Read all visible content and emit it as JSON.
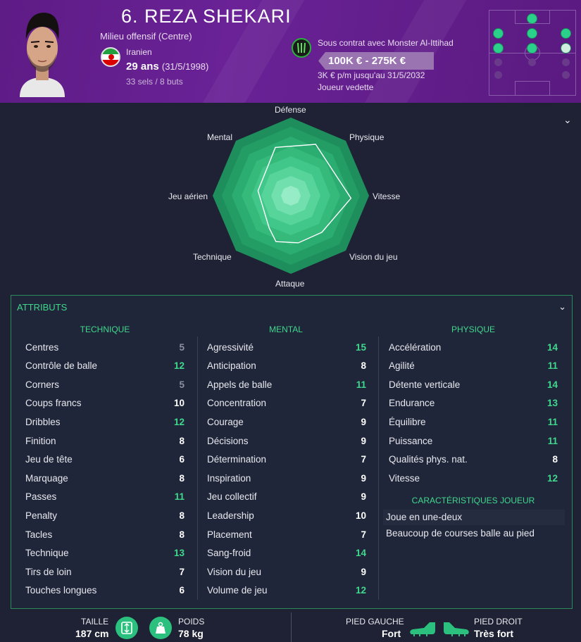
{
  "header": {
    "name": "6. REZA SHEKARI",
    "position": "Milieu offensif (Centre)",
    "nationality": "Iranien",
    "age": "29 ans",
    "dob": "(31/5/1998)",
    "caps": "33 sels / 8 buts",
    "contract": "Sous contrat avec Monster Al-Ittihad",
    "wage_range": "100K € - 275K €",
    "wage_detail": "3K € p/m jusqu'au 31/5/2032",
    "status": "Joueur vedette"
  },
  "radar": {
    "labels": {
      "defense": "Défense",
      "physique": "Physique",
      "vitesse": "Vitesse",
      "vision": "Vision du jeu",
      "attaque": "Attaque",
      "technique": "Technique",
      "jeu_aerien": "Jeu aérien",
      "mental": "Mental"
    }
  },
  "attributes": {
    "title": "ATTRIBUTS",
    "technique": {
      "heading": "TECHNIQUE",
      "rows": [
        {
          "label": "Centres",
          "value": "5"
        },
        {
          "label": "Contrôle de balle",
          "value": "12"
        },
        {
          "label": "Corners",
          "value": "5"
        },
        {
          "label": "Coups francs",
          "value": "10"
        },
        {
          "label": "Dribbles",
          "value": "12"
        },
        {
          "label": "Finition",
          "value": "8"
        },
        {
          "label": "Jeu de tête",
          "value": "6"
        },
        {
          "label": "Marquage",
          "value": "8"
        },
        {
          "label": "Passes",
          "value": "11"
        },
        {
          "label": "Penalty",
          "value": "8"
        },
        {
          "label": "Tacles",
          "value": "8"
        },
        {
          "label": "Technique",
          "value": "13"
        },
        {
          "label": "Tirs de loin",
          "value": "7"
        },
        {
          "label": "Touches longues",
          "value": "6"
        }
      ]
    },
    "mental": {
      "heading": "MENTAL",
      "rows": [
        {
          "label": "Agressivité",
          "value": "15"
        },
        {
          "label": "Anticipation",
          "value": "8"
        },
        {
          "label": "Appels de balle",
          "value": "11"
        },
        {
          "label": "Concentration",
          "value": "7"
        },
        {
          "label": "Courage",
          "value": "9"
        },
        {
          "label": "Décisions",
          "value": "9"
        },
        {
          "label": "Détermination",
          "value": "7"
        },
        {
          "label": "Inspiration",
          "value": "9"
        },
        {
          "label": "Jeu collectif",
          "value": "9"
        },
        {
          "label": "Leadership",
          "value": "10"
        },
        {
          "label": "Placement",
          "value": "7"
        },
        {
          "label": "Sang-froid",
          "value": "14"
        },
        {
          "label": "Vision du jeu",
          "value": "9"
        },
        {
          "label": "Volume de jeu",
          "value": "12"
        }
      ]
    },
    "physique": {
      "heading": "PHYSIQUE",
      "rows": [
        {
          "label": "Accélération",
          "value": "14"
        },
        {
          "label": "Agilité",
          "value": "11"
        },
        {
          "label": "Détente verticale",
          "value": "14"
        },
        {
          "label": "Endurance",
          "value": "13"
        },
        {
          "label": "Équilibre",
          "value": "11"
        },
        {
          "label": "Puissance",
          "value": "11"
        },
        {
          "label": "Qualités phys. nat.",
          "value": "8"
        },
        {
          "label": "Vitesse",
          "value": "12"
        }
      ]
    },
    "traits_heading": "CARACTÉRISTIQUES JOUEUR",
    "traits": [
      "Joue en une-deux",
      "Beaucoup de courses balle au pied"
    ]
  },
  "footer": {
    "height_label": "TAILLE",
    "height_value": "187 cm",
    "weight_label": "POIDS",
    "weight_value": "78 kg",
    "left_foot_label": "PIED GAUCHE",
    "left_foot_value": "Fort",
    "right_foot_label": "PIED DROIT",
    "right_foot_value": "Très fort"
  },
  "colors": {
    "accent_green": "#3fd88c",
    "header_purple": "#6a2296",
    "background": "#1e2234"
  }
}
